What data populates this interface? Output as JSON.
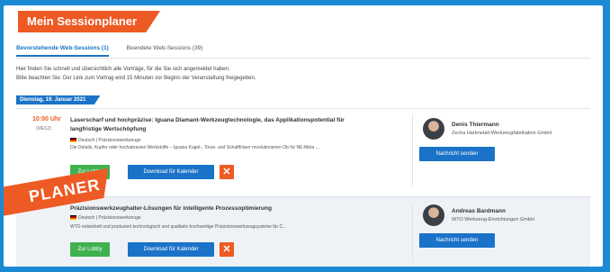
{
  "header": {
    "title": "Mein Sessionplaner"
  },
  "tabs": [
    {
      "label": "Bevorstehende Web-Sessions (1)",
      "active": true
    },
    {
      "label": "Beendete Web-Sessions (39)",
      "active": false
    }
  ],
  "intro": {
    "line1": "Hier finden Sie schnell und übersichtlich alle Vorträge, für die Sie sich angemeldet haben.",
    "line2": "Bitte beachten Sie: Der Link zum Vortrag wird 15 Minuten vor Beginn der Veranstaltung freigegeben."
  },
  "date_label": "Dienstag, 19. Januar 2021",
  "sessions": [
    {
      "time": "10:00 Uhr",
      "timezone": "(MESZ)",
      "title": "Laserscharf und hochpräzise: Iguana Diamant-Werkzeugtechnologie, das Applikationspotential für langfristige Wertschöpfung",
      "meta": "Deutsch | Präzisionswerkzeuge",
      "desc": "Die Details, Kupfer oder hochabrasive Werkstoffe – Iguana Kugel-, Torus- und Schaftfräser revolutionieren Ob für NE-Meta ...",
      "lobby_label": "Zur Lobby",
      "calendar_label": "Download für Kalender",
      "remove_label": "✕",
      "speaker_name": "Denis Thiermann",
      "speaker_company": "Zecha Hartmetall-Werkzeugfabrikation GmbH",
      "message_label": "Nachricht senden"
    },
    {
      "time": "",
      "timezone": "",
      "title": "Präzisionswerkzeughalter-Lösungen für intelligente Prozessoptimierung",
      "meta": "Deutsch | Präzisionswerkzeuge",
      "desc": "WTO entwickelt und produziert technologisch und qualitativ hochwertige Präzisionswerkzeugsysteme für C...",
      "lobby_label": "Zur Lobby",
      "calendar_label": "Download für Kalender",
      "remove_label": "✕",
      "speaker_name": "Andreas Bardmann",
      "speaker_company": "WTO Werkzeug-Einrichtungen GmbH",
      "message_label": "Nachricht senden"
    }
  ],
  "banner": {
    "text": "PLANER"
  },
  "colors": {
    "accent": "#ee5a24",
    "primary": "#1a73c8",
    "success": "#3fb24f",
    "background": "#1a8ad4"
  }
}
